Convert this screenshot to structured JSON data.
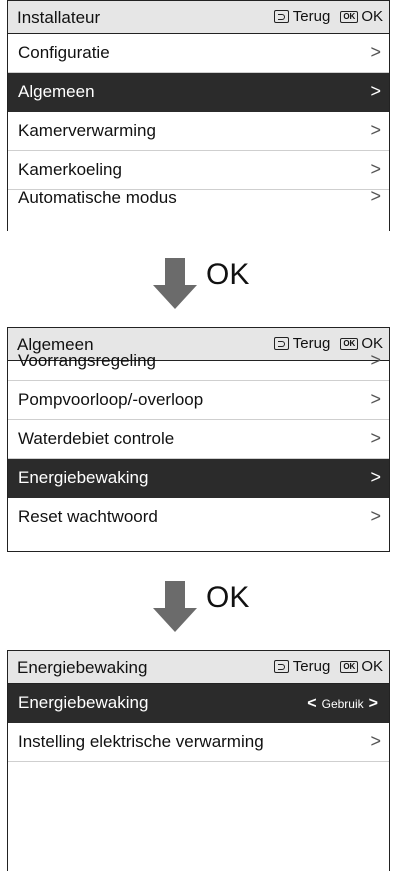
{
  "common": {
    "back_label": "Terug",
    "ok_badge": "OK",
    "ok_label": "OK",
    "chevron": ">"
  },
  "screen1": {
    "title": "Installateur",
    "items": [
      {
        "label": "Configuratie"
      },
      {
        "label": "Algemeen"
      },
      {
        "label": "Kamerverwarming"
      },
      {
        "label": "Kamerkoeling"
      },
      {
        "label": "Automatische modus"
      }
    ]
  },
  "step1": {
    "label": "OK"
  },
  "screen2": {
    "title": "Algemeen",
    "items": [
      {
        "label": "Voorrangsregeling"
      },
      {
        "label": "Pompvoorloop/-overloop"
      },
      {
        "label": "Waterdebiet controle"
      },
      {
        "label": "Energiebewaking"
      },
      {
        "label": "Reset wachtwoord"
      }
    ]
  },
  "step2": {
    "label": "OK"
  },
  "screen3": {
    "title": "Energiebewaking",
    "items": [
      {
        "label": "Energiebewaking",
        "value": "Gebruik",
        "left_arrow": "<",
        "right_arrow": ">"
      },
      {
        "label": "Instelling elektrische verwarming"
      }
    ]
  }
}
